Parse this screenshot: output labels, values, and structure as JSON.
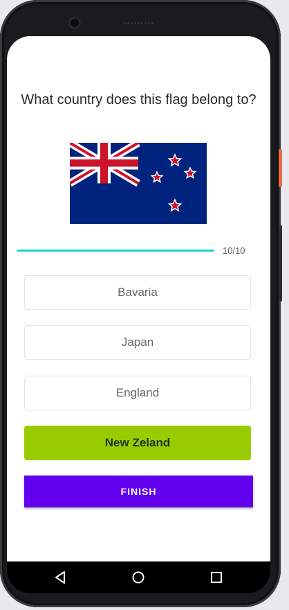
{
  "quiz": {
    "question": "What country does this flag belong to?",
    "flag_icon": "new-zealand-flag",
    "progress": {
      "current": 10,
      "total": 10,
      "fraction": 1.0,
      "label": "10/10"
    },
    "options": [
      {
        "label": "Bavaria",
        "state": "default"
      },
      {
        "label": "Japan",
        "state": "default"
      },
      {
        "label": "England",
        "state": "default"
      },
      {
        "label": "New Zeland",
        "state": "correct"
      }
    ],
    "finish_label": "FINISH"
  },
  "colors": {
    "progress_fill": "#16d7d5",
    "correct_option": "#99cc00",
    "primary_button": "#6200ee"
  },
  "navbar": {
    "icons": [
      "back-icon",
      "home-icon",
      "recents-icon"
    ]
  }
}
